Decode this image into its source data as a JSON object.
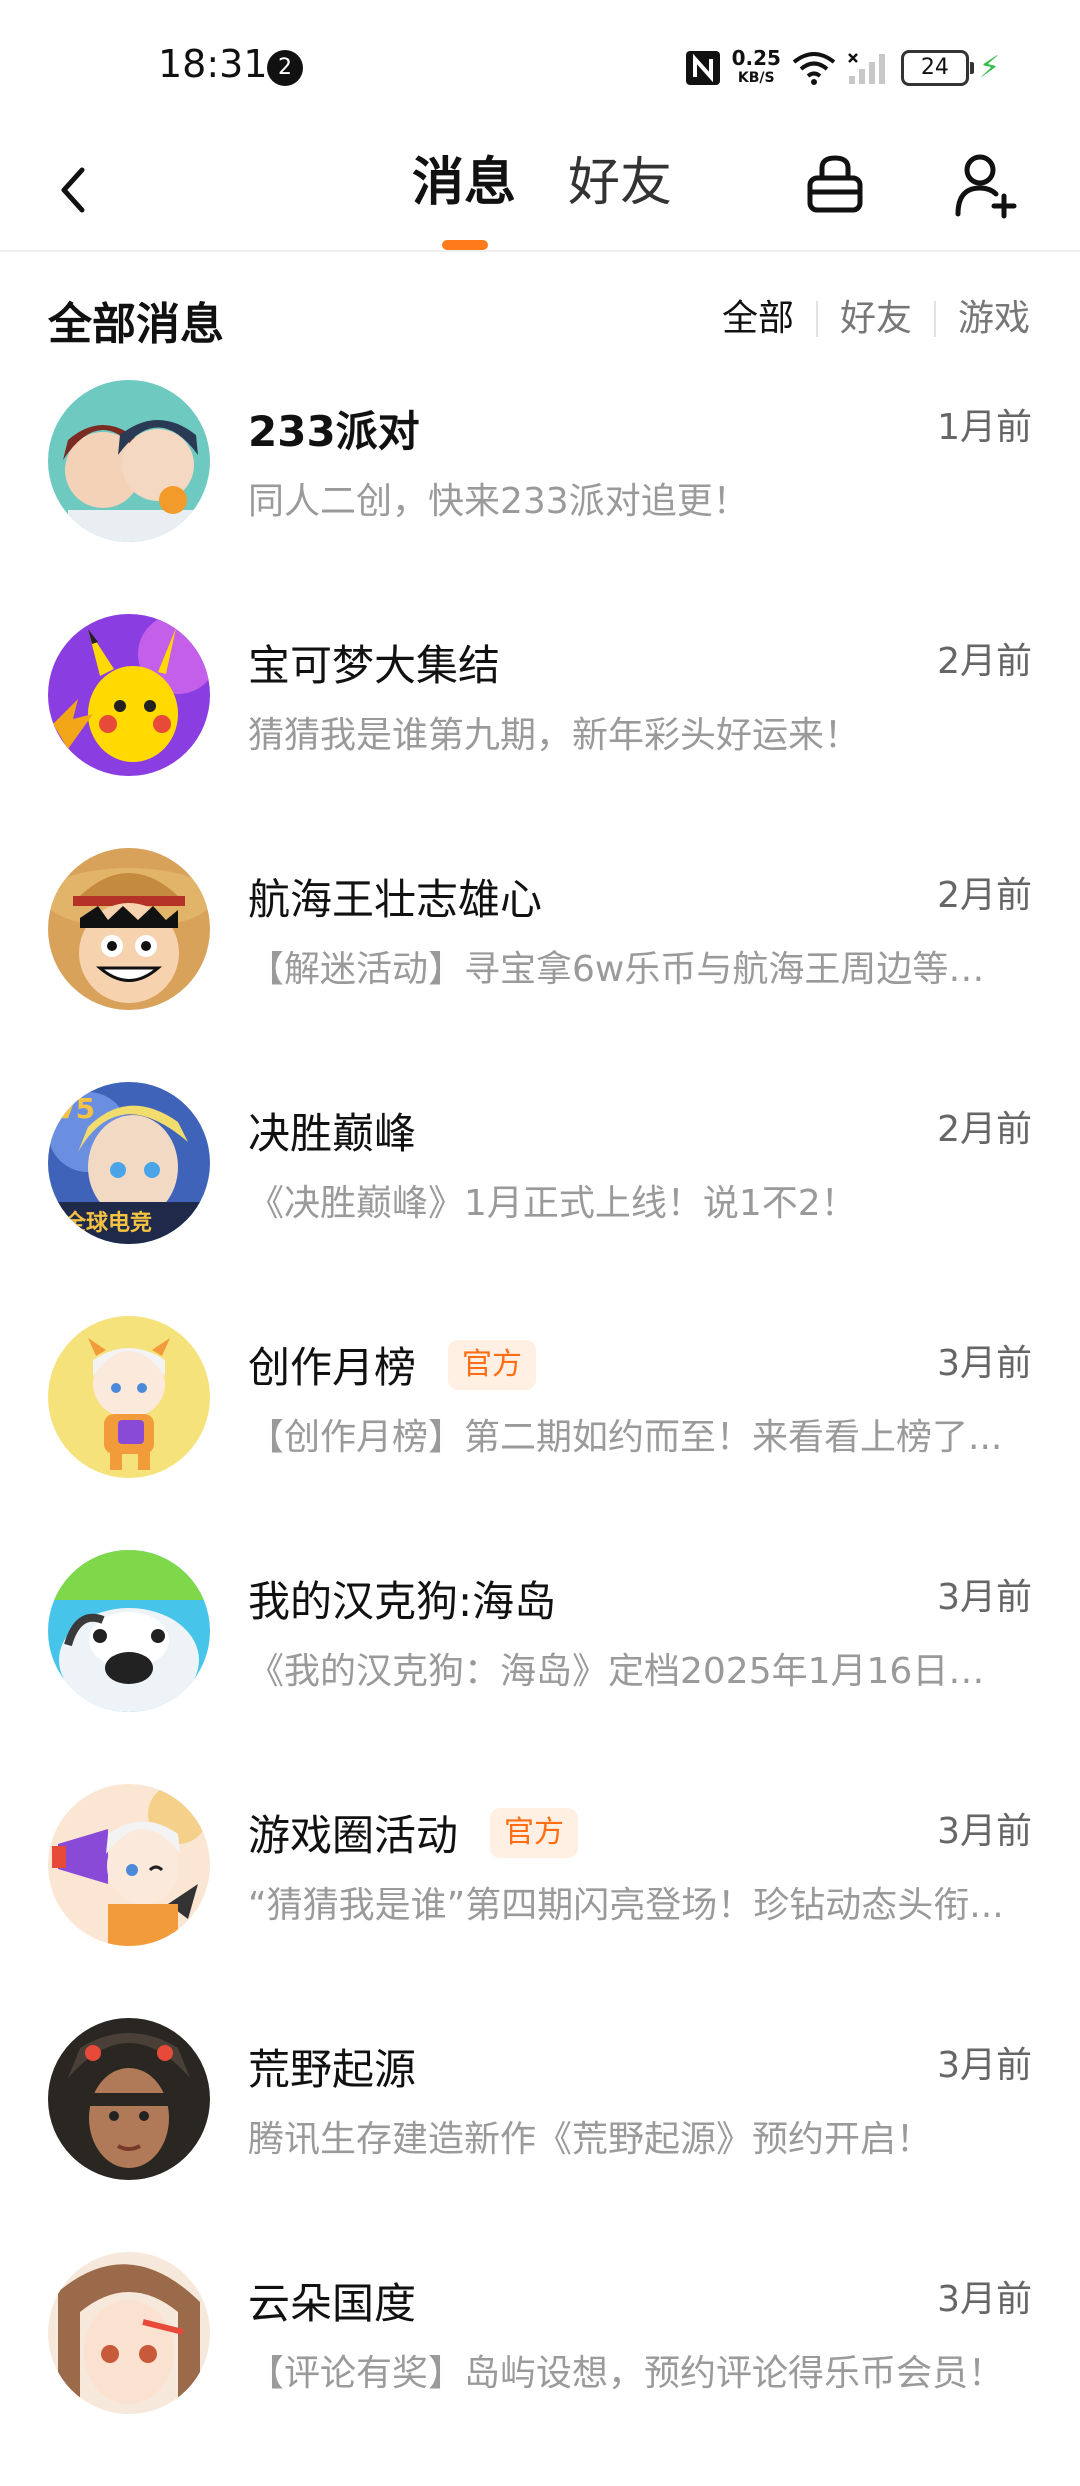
{
  "status_bar": {
    "time": "18:31",
    "notification_count": "2",
    "net_speed": "0.25",
    "net_unit": "KB/S",
    "battery": "24"
  },
  "header": {
    "tabs": [
      {
        "label": "消息",
        "active": true
      },
      {
        "label": "好友",
        "active": false
      }
    ]
  },
  "section": {
    "title": "全部消息",
    "filters": [
      {
        "label": "全部",
        "active": true
      },
      {
        "label": "好友",
        "active": false
      },
      {
        "label": "游戏",
        "active": false
      }
    ]
  },
  "messages": [
    {
      "title": "233派对",
      "preview": "同人二创，快来233派对追更！",
      "time": "1月前",
      "badge": ""
    },
    {
      "title": "宝可梦大集结",
      "preview": "猜猜我是谁第九期，新年彩头好运来！",
      "time": "2月前",
      "badge": ""
    },
    {
      "title": "航海王壮志雄心",
      "preview": "【解迷活动】寻宝拿6w乐币与航海王周边等神...",
      "time": "2月前",
      "badge": ""
    },
    {
      "title": "决胜巅峰",
      "preview": "《决胜巅峰》1月正式上线！说1不2！",
      "time": "2月前",
      "badge": ""
    },
    {
      "title": "创作月榜",
      "preview": "【创作月榜】第二期如约而至！来看看上榜了...",
      "time": "3月前",
      "badge": "官方"
    },
    {
      "title": "我的汉克狗:海岛",
      "preview": "《我的汉克狗：海岛》定档2025年1月16日上...",
      "time": "3月前",
      "badge": ""
    },
    {
      "title": "游戏圈活动",
      "preview": "“猜猜我是谁”第四期闪亮登场！珍钻动态头衔...",
      "time": "3月前",
      "badge": "官方"
    },
    {
      "title": "荒野起源",
      "preview": "腾讯生存建造新作《荒野起源》预约开启！",
      "time": "3月前",
      "badge": ""
    },
    {
      "title": "云朵国度",
      "preview": "【评论有奖】岛屿设想，预约评论得乐币会员！",
      "time": "3月前",
      "badge": ""
    }
  ],
  "colors": {
    "accent": "#ff7a1a",
    "badge_bg": "#fff0e3",
    "badge_text": "#ff6e14",
    "charging": "#2fbf4a"
  }
}
